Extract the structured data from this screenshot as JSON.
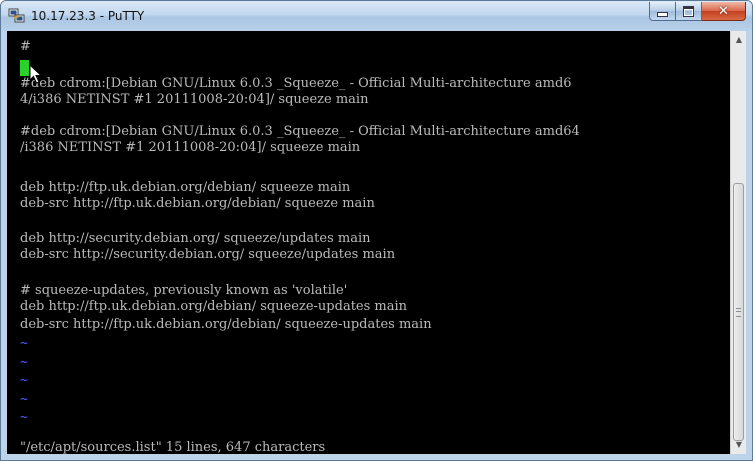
{
  "window": {
    "title": "10.17.23.3 - PuTTY",
    "icon": "putty-icon",
    "controls": {
      "minimize": "minimize-icon",
      "maximize": "maximize-icon",
      "close": "close-icon"
    }
  },
  "terminal": {
    "prompt": "#",
    "lines": [
      "#deb cdrom:[Debian GNU/Linux 6.0.3 _Squeeze_ - Official Multi-architecture amd6",
      "4/i386 NETINST #1 20111008-20:04]/ squeeze main",
      "#deb cdrom:[Debian GNU/Linux 6.0.3 _Squeeze_ - Official Multi-architecture amd64",
      "/i386 NETINST #1 20111008-20:04]/ squeeze main",
      "deb http://ftp.uk.debian.org/debian/ squeeze main",
      "deb-src http://ftp.uk.debian.org/debian/ squeeze main",
      "deb http://security.debian.org/ squeeze/updates main",
      "deb-src http://security.debian.org/ squeeze/updates main",
      "# squeeze-updates, previously known as 'volatile'",
      "deb http://ftp.uk.debian.org/debian/ squeeze-updates main",
      "deb-src http://ftp.uk.debian.org/debian/ squeeze-updates main"
    ],
    "empty_marker": "~",
    "status_line": "\"/etc/apt/sources.list\" 15 lines, 647 characters"
  },
  "colors": {
    "terminal_bg": "#000000",
    "terminal_fg": "#bbbbbb",
    "cursor": "#2bd12b",
    "tilde": "#5858ff"
  }
}
